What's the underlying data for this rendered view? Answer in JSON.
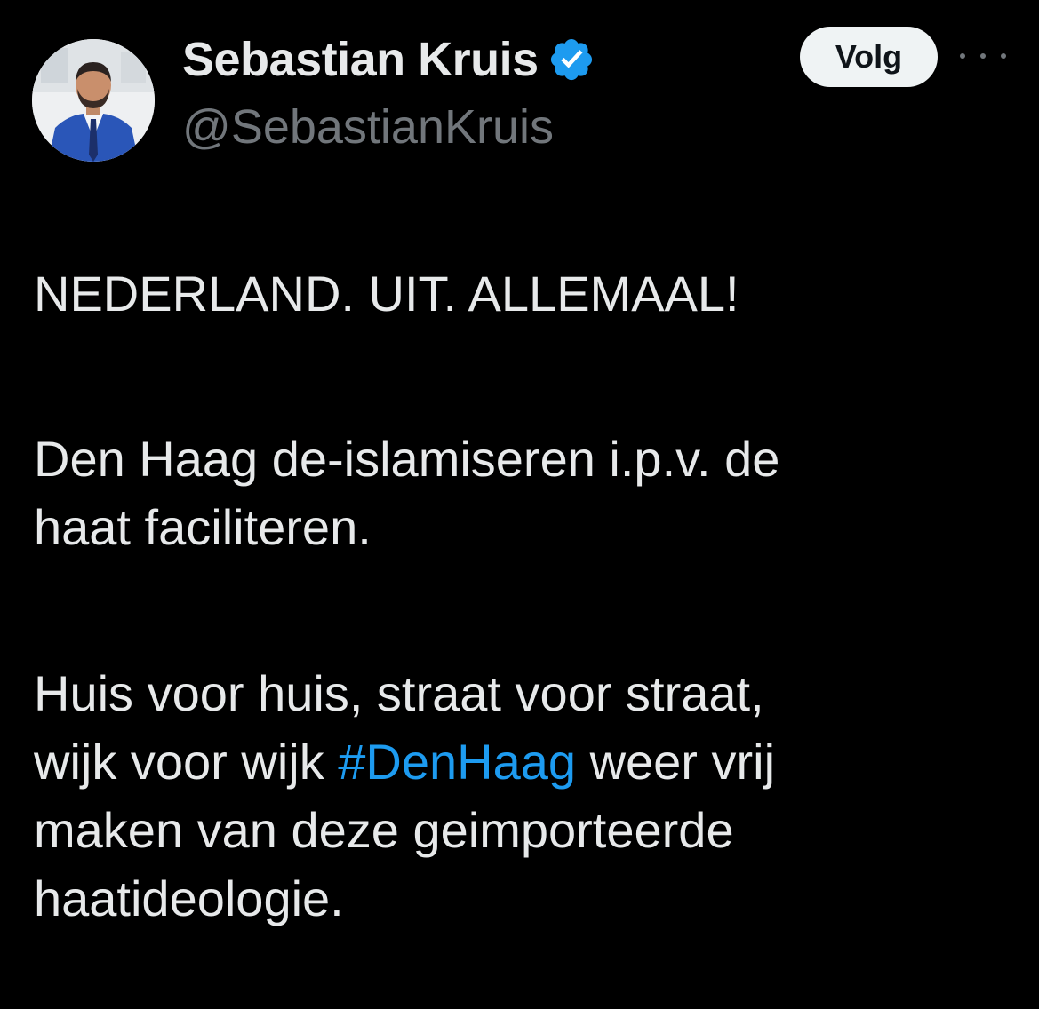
{
  "author": {
    "display_name": "Sebastian Kruis",
    "handle": "@SebastianKruis",
    "verified_icon": "verified-badge-icon",
    "verified_color": "#1d9bf0"
  },
  "actions": {
    "follow_label": "Volg",
    "more_icon": "more-options-icon"
  },
  "tweet": {
    "paragraph1": {
      "line1": "NEDERLAND. UIT. ALLEMAAL!"
    },
    "paragraph2": {
      "line1": "Den Haag de-islamiseren i.p.v. de",
      "line2": "haat faciliteren."
    },
    "paragraph3": {
      "line1": "Huis voor huis, straat voor straat,",
      "line2_before": "wijk voor wijk ",
      "line2_hashtag": "#DenHaag",
      "line2_after": " weer vrij",
      "line3": "maken van deze geimporteerde",
      "line4": "haatideologie."
    }
  },
  "colors": {
    "background": "#000000",
    "text": "#e7e9ea",
    "secondary_text": "#71767b",
    "link": "#1d9bf0"
  }
}
